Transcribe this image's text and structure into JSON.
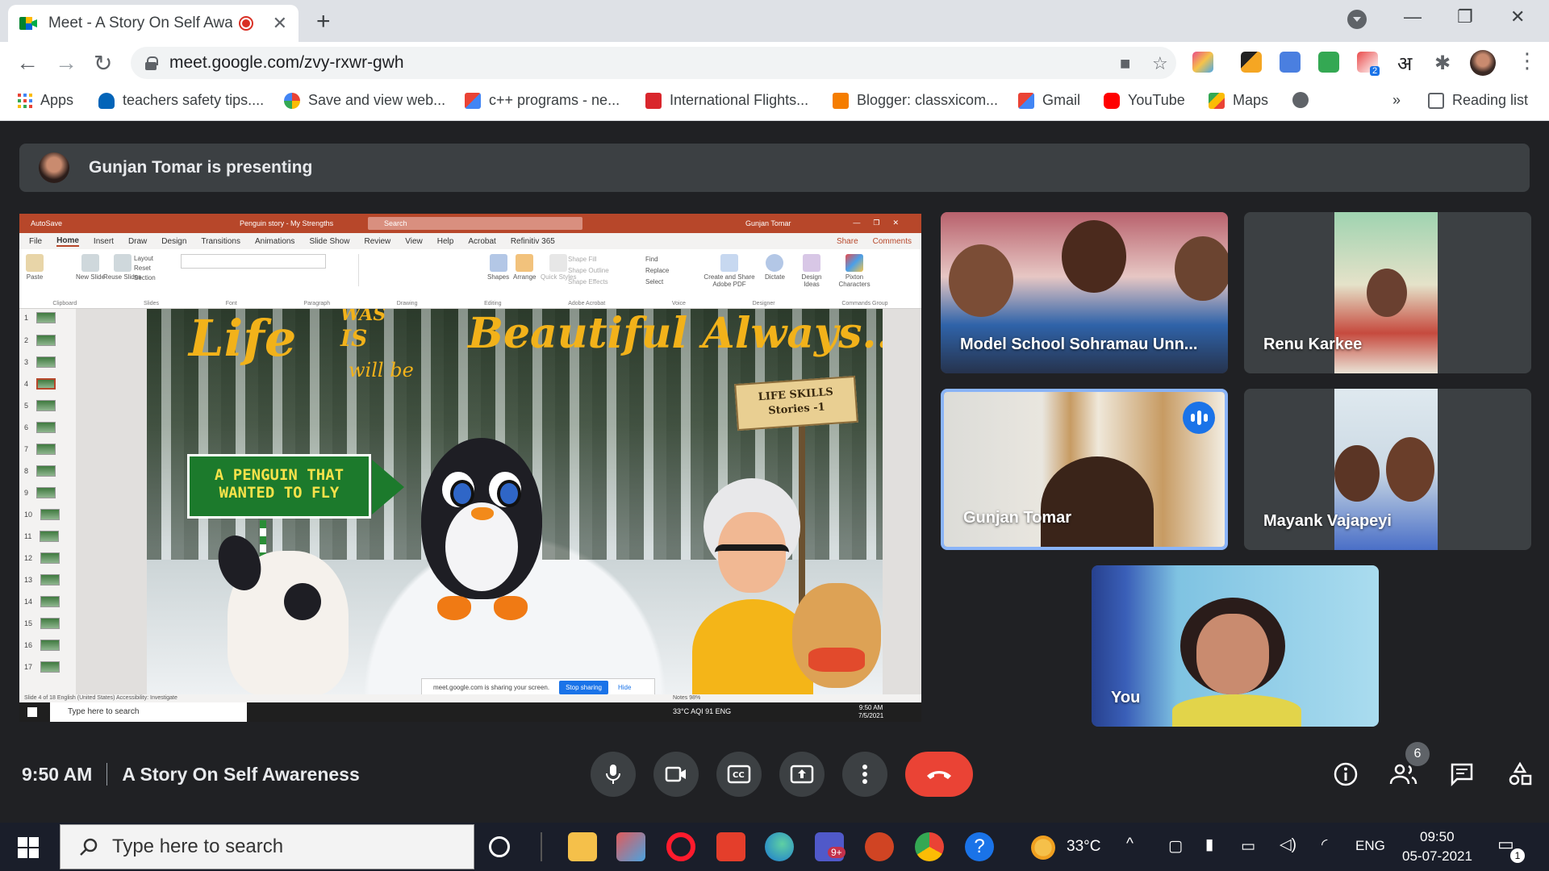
{
  "browser": {
    "tab_title": "Meet - A Story On Self Awaren",
    "url": "meet.google.com/zvy-rxwr-gwh",
    "new_tab_label": "+",
    "tab_close": "✕"
  },
  "bookmarks": [
    {
      "label": "Apps"
    },
    {
      "label": "teachers safety tips...."
    },
    {
      "label": "Save and view web..."
    },
    {
      "label": "c++ programs - ne..."
    },
    {
      "label": "International Flights..."
    },
    {
      "label": "Blogger: classxicom..."
    },
    {
      "label": "Gmail"
    },
    {
      "label": "YouTube"
    },
    {
      "label": "Maps"
    }
  ],
  "bookmarks_more": "»",
  "reading_list": "Reading list",
  "extension_hindi": "अ",
  "extension_badge": "2",
  "presenting": {
    "text": "Gunjan Tomar is presenting"
  },
  "shared_screen": {
    "ppt_title": "Penguin story - My Strengths",
    "ppt_autosave": "AutoSave",
    "ppt_search": "Search",
    "ppt_user": "Gunjan Tomar",
    "ppt_menu": [
      "File",
      "Home",
      "Insert",
      "Draw",
      "Design",
      "Transitions",
      "Animations",
      "Slide Show",
      "Review",
      "View",
      "Help",
      "Acrobat",
      "Refinitiv 365"
    ],
    "ppt_share": "Share",
    "ppt_comments": "Comments",
    "ribbon_groups": [
      "Clipboard",
      "Slides",
      "Font",
      "Paragraph",
      "Drawing",
      "Editing",
      "Adobe Acrobat",
      "Voice",
      "Designer",
      "Commands Group"
    ],
    "ribbon_buttons": [
      "Paste",
      "New Slide",
      "Reuse Slides",
      "Layout",
      "Reset",
      "Section",
      "Shapes",
      "Arrange",
      "Quick Styles",
      "Shape Fill",
      "Shape Outline",
      "Shape Effects",
      "Find",
      "Replace",
      "Select",
      "Create and Share Adobe PDF",
      "Dictate",
      "Design Ideas",
      "Pixton Characters"
    ],
    "slide_numbers": [
      "1",
      "2",
      "3",
      "4",
      "5",
      "6",
      "7",
      "8",
      "9",
      "10",
      "11",
      "12",
      "13",
      "14",
      "15",
      "16",
      "17"
    ],
    "slide_text": {
      "life": "Life",
      "was": "WAS",
      "is": "IS",
      "will_be": "will be",
      "beautiful": "Beautiful Always...",
      "sign": "A PENGUIN THAT WANTED TO FLY",
      "wood_sign_1": "LIFE SKILLS",
      "wood_sign_2": "Stories -1"
    },
    "share_notice": "meet.google.com is sharing your screen.",
    "stop_sharing": "Stop sharing",
    "hide": "Hide",
    "status": "Slide 4 of 18     English (United States)     Accessibility: Investigate",
    "status_right": "Notes   98%",
    "inner_search": "Type here to search",
    "inner_tray": "33°C  AQI 91     ENG",
    "inner_time": "9:50 AM",
    "inner_date": "7/5/2021"
  },
  "participants": [
    {
      "name": "Model School Sohramau Unn..."
    },
    {
      "name": "Renu Karkee"
    },
    {
      "name": "Gunjan Tomar"
    },
    {
      "name": "Mayank Vajapeyi"
    },
    {
      "name": "You"
    }
  ],
  "meeting": {
    "time": "9:50 AM",
    "title": "A Story On Self Awareness",
    "participant_count": "6"
  },
  "taskbar": {
    "search_placeholder": "Type here to search",
    "weather": "33°C",
    "lang": "ENG",
    "time": "09:50",
    "date": "05-07-2021",
    "teams_badge": "9+",
    "notif_count": "1"
  }
}
